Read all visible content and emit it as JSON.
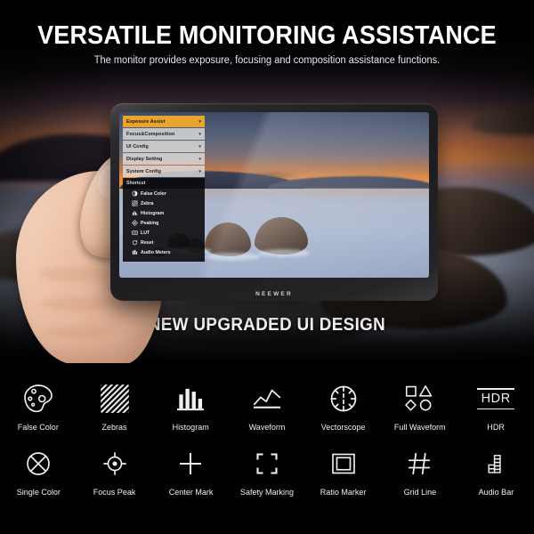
{
  "header": {
    "title": "VERSATILE MONITORING ASSISTANCE",
    "subtitle": "The monitor provides exposure, focusing and composition assistance functions."
  },
  "tagline": "NEW UPGRADED UI DESIGN",
  "monitor": {
    "brand": "NEEWER",
    "osd": {
      "menu_items": [
        {
          "label": "Exposure  Assist",
          "active": true,
          "chevron": "chevron-down-icon"
        },
        {
          "label": "Focus&Composition",
          "active": false,
          "chevron": "chevron-down-icon"
        },
        {
          "label": "UI  Config",
          "active": false,
          "chevron": "chevron-down-icon"
        },
        {
          "label": "Display  Setting",
          "active": false,
          "chevron": "chevron-down-icon"
        },
        {
          "label": "System  Config",
          "active": false,
          "chevron": "chevron-down-icon"
        }
      ],
      "shortcut_title": "Shortcut",
      "shortcut_items": [
        {
          "label": "False  Color",
          "icon": "false-color-icon"
        },
        {
          "label": "Zebra",
          "icon": "zebra-icon"
        },
        {
          "label": "Histogram",
          "icon": "histogram-icon"
        },
        {
          "label": "Peaking",
          "icon": "peaking-icon"
        },
        {
          "label": "LUT",
          "icon": "lut-icon"
        },
        {
          "label": "Reset",
          "icon": "reset-icon"
        },
        {
          "label": "Audio  Meters",
          "icon": "audio-meters-icon"
        }
      ]
    }
  },
  "features": {
    "row1": [
      {
        "label": "False Color",
        "icon": "false-color-icon"
      },
      {
        "label": "Zebras",
        "icon": "zebras-icon"
      },
      {
        "label": "Histogram",
        "icon": "histogram-icon"
      },
      {
        "label": "Waveform",
        "icon": "waveform-icon"
      },
      {
        "label": "Vectorscope",
        "icon": "vectorscope-icon"
      },
      {
        "label": "Full Waveform",
        "icon": "full-waveform-icon"
      },
      {
        "label": "HDR",
        "icon": "hdr-icon",
        "glyph_text": "HDR"
      }
    ],
    "row2": [
      {
        "label": "Single Color",
        "icon": "single-color-icon"
      },
      {
        "label": "Focus Peak",
        "icon": "focus-peak-icon"
      },
      {
        "label": "Center Mark",
        "icon": "center-mark-icon"
      },
      {
        "label": "Safety Marking",
        "icon": "safety-marking-icon"
      },
      {
        "label": "Ratio Marker",
        "icon": "ratio-marker-icon"
      },
      {
        "label": "Grid Line",
        "icon": "grid-line-icon"
      },
      {
        "label": "Audio Bar",
        "icon": "audio-bar-icon"
      }
    ]
  },
  "colors": {
    "accent_orange": "#E8A42F",
    "panel_background": "#000000",
    "icon_stroke": "#EFEFEF",
    "text_primary": "#FFFFFF"
  }
}
